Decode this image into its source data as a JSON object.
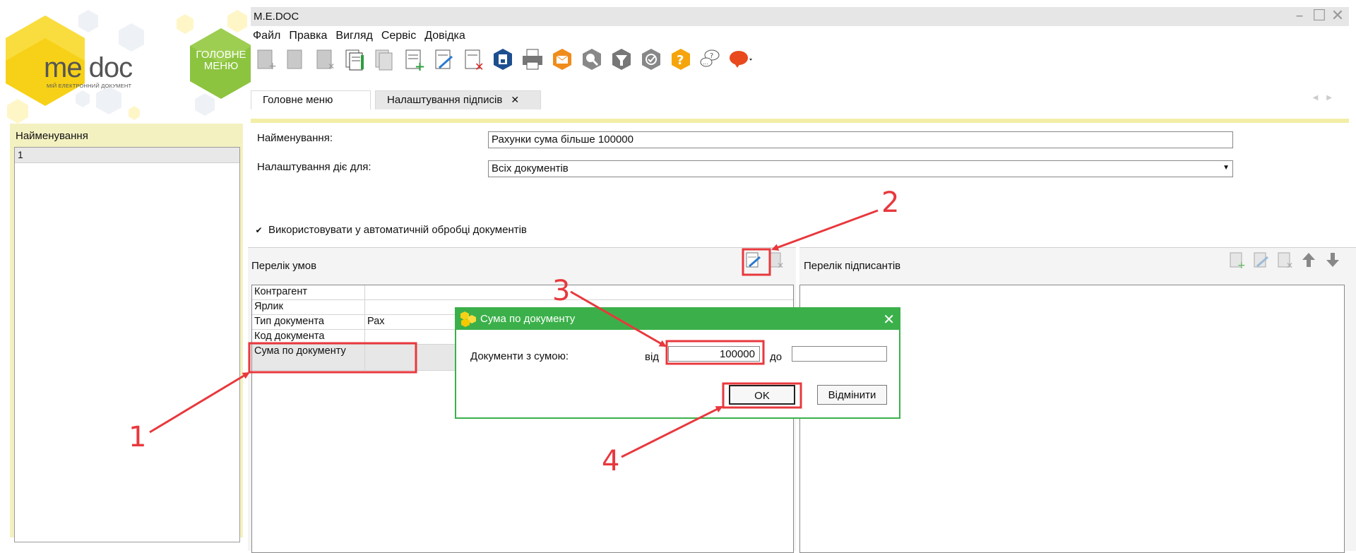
{
  "logo": {
    "brand": "me doc",
    "tagline": "МІЙ ЕЛЕКТРОННИЙ ДОКУМЕНТ",
    "home_label": "ГОЛОВНЕ МЕНЮ"
  },
  "window": {
    "title": "M.E.DOC"
  },
  "menu": {
    "items": [
      "Файл",
      "Правка",
      "Вигляд",
      "Сервіс",
      "Довідка"
    ]
  },
  "toolbar": {
    "icons": [
      "new-document-icon",
      "open-document-icon",
      "delete-document-icon",
      "copy-icon",
      "duplicate-icon",
      "add-row-icon",
      "edit-row-icon",
      "delete-row-icon",
      "save-icon",
      "print-icon",
      "send-icon",
      "search-icon",
      "filter-icon",
      "sign-icon",
      "help-icon",
      "chat-icon",
      "feedback-icon"
    ]
  },
  "tabs": {
    "home": "Головне меню",
    "sign_settings": "Налаштування підписів",
    "close": "✕"
  },
  "left": {
    "header": "Найменування",
    "rows": [
      "1"
    ]
  },
  "form": {
    "name_label": "Найменування:",
    "name_value": "Рахунки сума більше 100000",
    "applies_label": "Налаштування діє для:",
    "applies_value": "Всіх документів",
    "auto_checkbox": "Використовувати у автоматичній обробці документів",
    "auto_checked": true
  },
  "conditions": {
    "title": "Перелік умов",
    "rows": [
      {
        "name": "Контрагент",
        "value": ""
      },
      {
        "name": "Ярлик",
        "value": ""
      },
      {
        "name": "Тип документа",
        "value": "Рах"
      },
      {
        "name": "Код документа",
        "value": ""
      },
      {
        "name": "Сума по документу",
        "value": ""
      }
    ]
  },
  "signatories": {
    "title": "Перелік підписантів"
  },
  "dialog": {
    "title": "Сума по документу",
    "label": "Документи з сумою:",
    "from_label": "від",
    "from_value": "100000",
    "to_label": "до",
    "to_value": "",
    "ok": "OK",
    "cancel": "Відмінити"
  },
  "annotations": {
    "n1": "1",
    "n2": "2",
    "n3": "3",
    "n4": "4",
    "color": "#e8383d"
  }
}
